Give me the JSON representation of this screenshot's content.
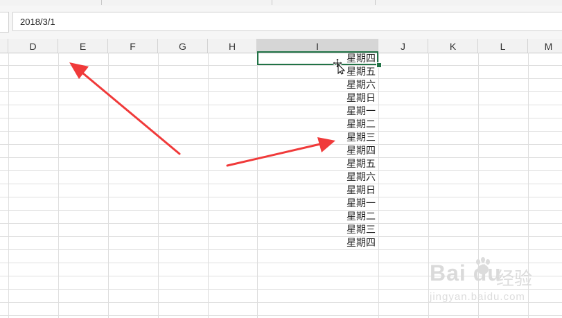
{
  "formula_bar": {
    "value": "2018/3/1"
  },
  "columns": [
    {
      "label": "D",
      "active": false
    },
    {
      "label": "E",
      "active": false
    },
    {
      "label": "F",
      "active": false
    },
    {
      "label": "G",
      "active": false
    },
    {
      "label": "H",
      "active": false
    },
    {
      "label": "I",
      "active": true
    },
    {
      "label": "J",
      "active": false
    },
    {
      "label": "K",
      "active": false
    },
    {
      "label": "L",
      "active": false
    },
    {
      "label": "M",
      "active": false
    }
  ],
  "column_i_cells": [
    "星期四",
    "星期五",
    "星期六",
    "星期日",
    "星期一",
    "星期二",
    "星期三",
    "星期四",
    "星期五",
    "星期六",
    "星期日",
    "星期一",
    "星期二",
    "星期三",
    "星期四"
  ],
  "selection": {
    "cell": "I",
    "border_color": "#217346"
  },
  "annotations": {
    "arrow_color": "#f03a3a"
  },
  "watermark": {
    "brand": "Bai du",
    "chinese": "经验",
    "url": "jingyan.baidu.com"
  }
}
